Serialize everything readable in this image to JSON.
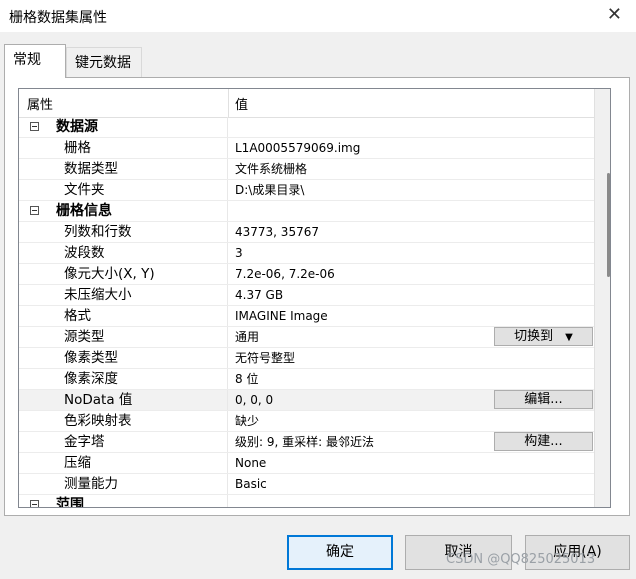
{
  "window": {
    "title": "栅格数据集属性",
    "close_glyph": "✕"
  },
  "tabs": [
    {
      "label": "常规"
    },
    {
      "label": "键元数据"
    }
  ],
  "grid": {
    "header": {
      "property": "属性",
      "value": "值"
    },
    "rows": [
      {
        "kind": "category",
        "label": "数据源",
        "toggle": "minus"
      },
      {
        "kind": "prop",
        "label": "栅格",
        "value": "L1A0005579069.img"
      },
      {
        "kind": "prop",
        "label": "数据类型",
        "value": "文件系统栅格"
      },
      {
        "kind": "prop",
        "label": "文件夹",
        "value": "D:\\成果目录\\"
      },
      {
        "kind": "category",
        "label": "栅格信息",
        "toggle": "minus"
      },
      {
        "kind": "prop",
        "label": "列数和行数",
        "value": "43773, 35767"
      },
      {
        "kind": "prop",
        "label": "波段数",
        "value": "3"
      },
      {
        "kind": "prop",
        "label": "像元大小(X, Y)",
        "value": "7.2e-06, 7.2e-06"
      },
      {
        "kind": "prop",
        "label": "未压缩大小",
        "value": "4.37 GB"
      },
      {
        "kind": "prop",
        "label": "格式",
        "value": "IMAGINE Image"
      },
      {
        "kind": "prop",
        "label": "源类型",
        "value": "通用",
        "button": "切换到",
        "dropdown": true
      },
      {
        "kind": "prop",
        "label": "像素类型",
        "value": "无符号整型"
      },
      {
        "kind": "prop",
        "label": "像素深度",
        "value": "8 位"
      },
      {
        "kind": "prop",
        "label": "NoData 值",
        "value": "0, 0, 0",
        "button": "编辑...",
        "selected": true
      },
      {
        "kind": "prop",
        "label": "色彩映射表",
        "value": "缺少"
      },
      {
        "kind": "prop",
        "label": "金字塔",
        "value": "级别: 9, 重采样: 最邻近法",
        "button": "构建..."
      },
      {
        "kind": "prop",
        "label": "压缩",
        "value": "None"
      },
      {
        "kind": "prop",
        "label": "测量能力",
        "value": "Basic"
      },
      {
        "kind": "category",
        "label": "范围",
        "toggle": "minus"
      }
    ]
  },
  "buttons": {
    "ok": "确定",
    "cancel": "取消",
    "apply": "应用(A)"
  },
  "watermark": "CSDN @QQ825025013",
  "icons": {
    "collapse": "minus-box-icon",
    "dropdown": "triangle-down-icon",
    "close": "close-icon"
  }
}
